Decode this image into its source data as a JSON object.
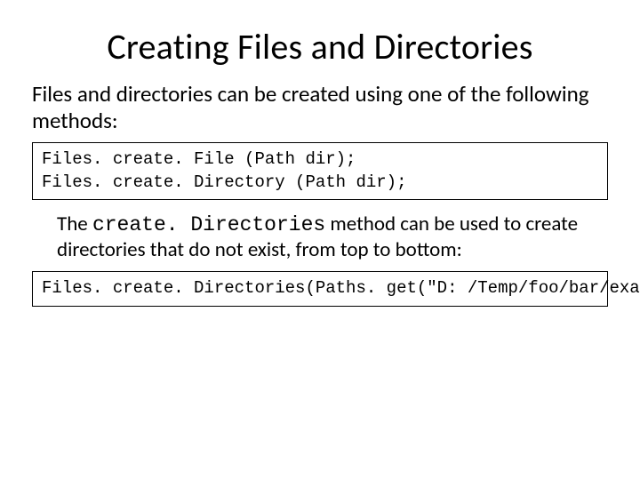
{
  "title": "Creating Files and Directories",
  "intro": "Files and directories can be created using one of the following methods:",
  "code1_line1": "Files. create. File (Path dir);",
  "code1_line2": "Files. create. Directory (Path dir);",
  "desc_pre": "The ",
  "desc_mono": "create. Directories",
  "desc_post": " method can be used to create directories that do not exist, from top to bottom:",
  "code2": "Files. create. Directories(Paths. get(\"D: /Temp/foo/bar/example\"));"
}
